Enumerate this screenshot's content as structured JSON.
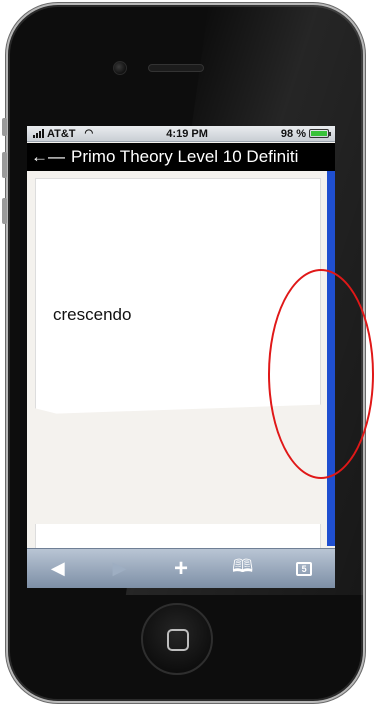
{
  "status_bar": {
    "carrier": "AT&T",
    "time": "4:19 PM",
    "battery": "98 %",
    "battery_level": 0.98
  },
  "title_bar": {
    "title": "Primo Theory Level 10 Definiti"
  },
  "flashcard": {
    "term": "crescendo"
  },
  "toolbar": {
    "tabs_count": "5"
  },
  "colors": {
    "annotation_circle": "#e01818",
    "scrollbar": "#1f4fd0"
  }
}
